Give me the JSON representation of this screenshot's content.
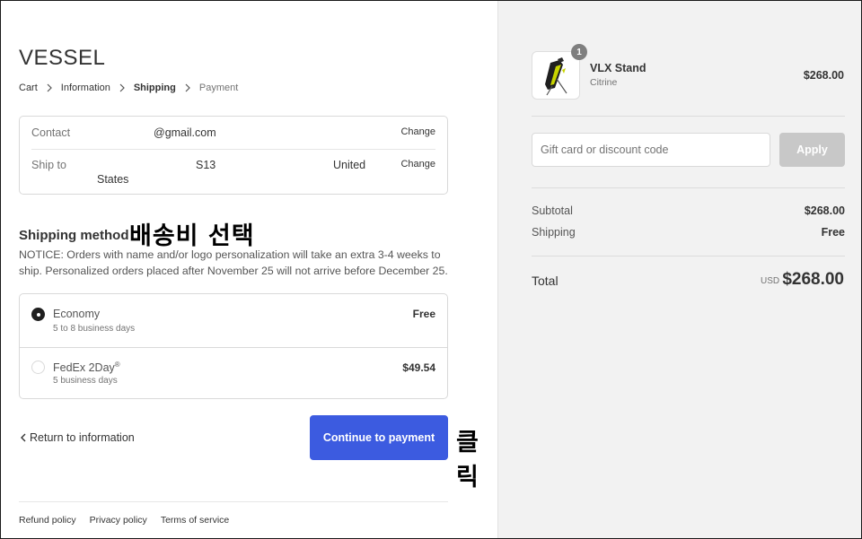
{
  "store": {
    "brand": "VESSEL"
  },
  "breadcrumb": [
    {
      "label": "Cart"
    },
    {
      "label": "Information"
    },
    {
      "label": "Shipping"
    },
    {
      "label": "Payment"
    }
  ],
  "contact": {
    "label": "Contact",
    "value": "@gmail.com",
    "change_label": "Change"
  },
  "ship_to": {
    "label": "Ship to",
    "value_part1": "S13",
    "value_part2": "United",
    "value_part3": "States",
    "change_label": "Change"
  },
  "shipping_method": {
    "title": "Shipping method",
    "notice": "NOTICE: Orders with name and/or logo personalization will take an extra 3-4 weeks to ship. Personalized orders placed after November 25 will not arrive before December 25.",
    "options": [
      {
        "name": "Economy",
        "sub": "5 to 8 business days",
        "price": "Free",
        "selected": true
      },
      {
        "name": "FedEx 2Day",
        "mark": "®",
        "sub": "5 business days",
        "price": "$49.54",
        "selected": false
      }
    ]
  },
  "annotations": {
    "select_shipping": "배송비 선택",
    "click": "클릭"
  },
  "actions": {
    "return_label": "Return to information",
    "continue_label": "Continue to payment"
  },
  "footer": {
    "links": [
      "Refund policy",
      "Privacy policy",
      "Terms of service"
    ]
  },
  "order": {
    "product": {
      "name": "VLX Stand",
      "variant": "Citrine",
      "price": "$268.00",
      "quantity": "1"
    },
    "discount": {
      "placeholder": "Gift card or discount code",
      "apply_label": "Apply"
    },
    "subtotal": {
      "label": "Subtotal",
      "value": "$268.00"
    },
    "shipping": {
      "label": "Shipping",
      "value": "Free"
    },
    "total": {
      "label": "Total",
      "currency": "USD",
      "value": "$268.00"
    }
  },
  "colors": {
    "primary_button": "#3c5be0",
    "sidebar_bg": "#f2f2f2",
    "apply_disabled": "#c8c8c8"
  }
}
